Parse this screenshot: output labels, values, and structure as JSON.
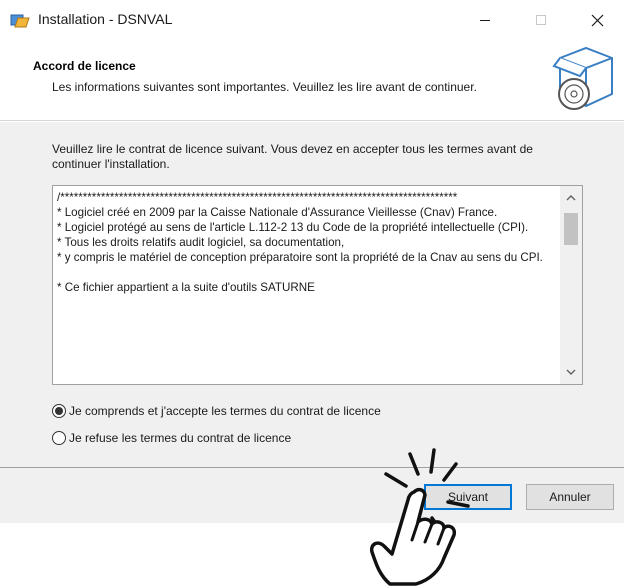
{
  "window": {
    "title": "Installation - DSNVAL",
    "minimize_icon": "minimize-icon",
    "maximize_icon": "maximize-icon",
    "close_icon": "close-icon"
  },
  "header": {
    "title": "Accord de licence",
    "subtitle": "Les informations suivantes sont importantes. Veuillez les lire avant de continuer.",
    "icon": "setup-box-cd-icon"
  },
  "body": {
    "instruction": "Veuillez lire le contrat de licence suivant. Vous devez en accepter tous les termes avant de continuer l'installation.",
    "license_text": "/****************************************************************************************\n* Logiciel créé en 2009 par la Caisse Nationale d'Assurance Vieillesse (Cnav) France.\n* Logiciel protégé au sens de l'article L.112-2 13 du Code de la propriété intellectuelle (CPI).\n* Tous les droits relatifs audit logiciel, sa documentation,\n* y compris le matériel de conception préparatoire sont la propriété de la Cnav au sens du CPI.\n\n* Ce fichier appartient a la suite d'outils SATURNE",
    "accept_label": "Je comprends et j'accepte les termes du contrat de licence",
    "refuse_label": "Je refuse les termes du contrat de licence",
    "selected": "accept"
  },
  "footer": {
    "next_label": "Suivant",
    "cancel_label": "Annuler"
  },
  "overlay": {
    "icon": "tap-hand-icon"
  }
}
